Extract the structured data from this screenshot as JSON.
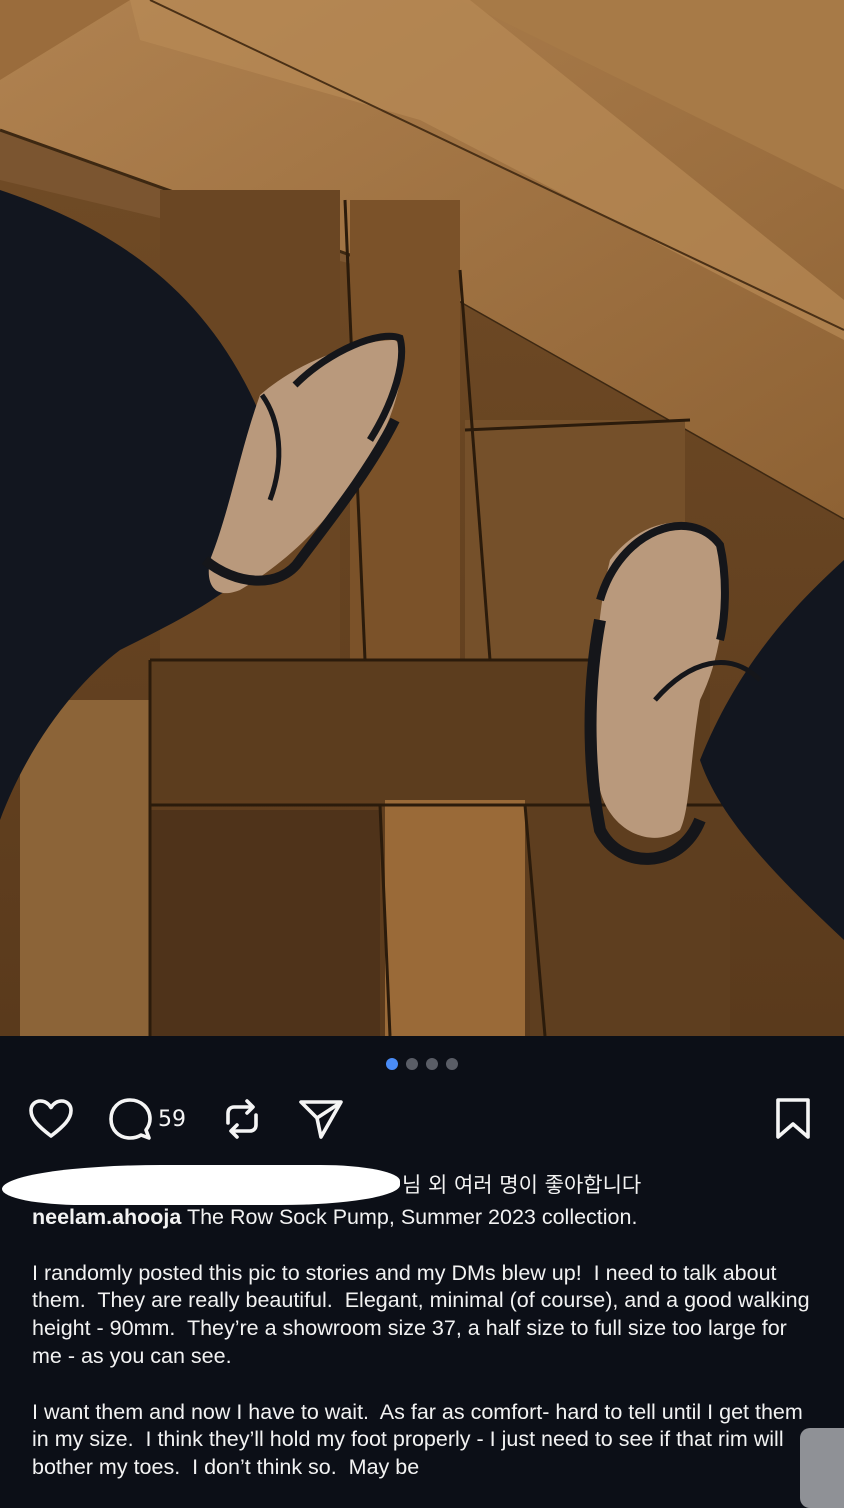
{
  "post": {
    "carousel": {
      "count": 4,
      "active_index": 0
    },
    "comment_count": "59",
    "likes_text": "님 외 여러 명이 좋아합니다",
    "caption": {
      "username": "neelam.ahooja",
      "headline": " The Row Sock Pump, Summer 2023 collection.",
      "paragraph_1": "I randomly posted this pic to stories and my DMs blew up!  I need to talk about them.  They are really beautiful.  Elegant, minimal (of course), and a good walking height - 90mm.  They’re a showroom size 37, a half size to full size too large for me - as you can see.",
      "paragraph_2": "I want them and now I have to wait.  As far as comfort- hard to tell until I get them in my size.  I think they’ll hold my foot properly - I just need to see if that rim will bother my toes.  I don’t think so.  May be"
    }
  },
  "icons": {
    "like": "heart-icon",
    "comment": "comment-bubble-icon",
    "repost": "repost-icon",
    "share": "send-icon",
    "save": "bookmark-icon"
  },
  "colors": {
    "background": "#0c0f17",
    "active_dot": "#4a8cf7",
    "inactive_dot": "#5a5d66"
  }
}
